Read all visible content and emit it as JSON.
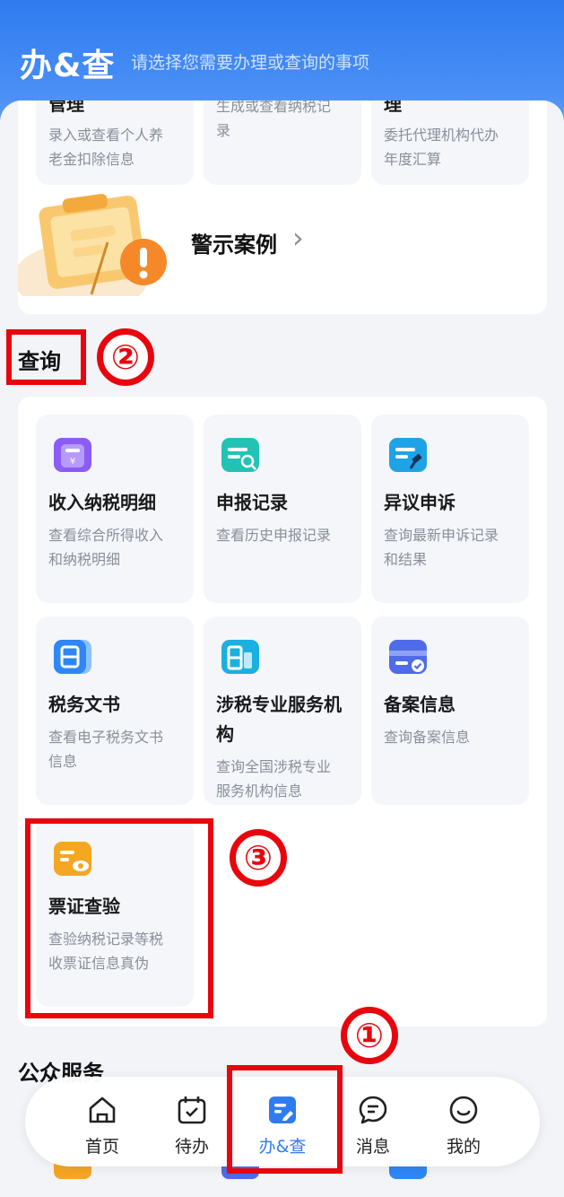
{
  "header": {
    "title": "办&查",
    "subtitle": "请选择您需要办理或查询的事项"
  },
  "top_tiles": [
    {
      "title": "管理",
      "desc_line1": "录入或查看个人养",
      "desc_line2": "老金扣除信息"
    },
    {
      "title": "",
      "desc_line1": "生成或查看纳税记",
      "desc_line2": "录"
    },
    {
      "title": "理",
      "desc_line1": "委托代理机构代办",
      "desc_line2": "年度汇算"
    }
  ],
  "warning": {
    "label": "警示案例",
    "chevron": "›"
  },
  "query_section": {
    "title": "查询",
    "tiles": [
      {
        "title": "收入纳税明细",
        "desc_line1": "查看综合所得收入",
        "desc_line2": "和纳税明细",
        "icon": "income-detail-icon",
        "color": "#8b5cf6"
      },
      {
        "title": "申报记录",
        "desc_line1": "查看历史申报记录",
        "desc_line2": "",
        "icon": "declaration-record-icon",
        "color": "#22c3b5"
      },
      {
        "title": "异议申诉",
        "desc_line1": "查询最新申诉记录",
        "desc_line2": "和结果",
        "icon": "appeal-icon",
        "color": "#1fa3e6"
      },
      {
        "title": "税务文书",
        "desc_line1": "查看电子税务文书",
        "desc_line2": "信息",
        "icon": "tax-document-icon",
        "color": "#2f86f6"
      },
      {
        "title_line1": "涉税专业服务机",
        "title_line2": "构",
        "desc_line1": "查询全国涉税专业",
        "desc_line2": "服务机构信息",
        "icon": "tax-agency-icon",
        "color": "#1ab0e0"
      },
      {
        "title": "备案信息",
        "desc_line1": "查询备案信息",
        "desc_line2": "",
        "icon": "filing-info-icon",
        "color": "#4f6be8"
      },
      {
        "title": "票证查验",
        "desc_line1": "查验纳税记录等税",
        "desc_line2": "收票证信息真伪",
        "icon": "ticket-verify-icon",
        "color": "#f5a623"
      }
    ]
  },
  "public_section": {
    "title": "公众服务"
  },
  "annotations": {
    "one": "①",
    "two": "②",
    "three": "③",
    "color": "#e8050d"
  },
  "tabbar": {
    "items": [
      {
        "label": "首页",
        "icon": "home-icon",
        "active": false
      },
      {
        "label": "待办",
        "icon": "todo-icon",
        "active": false
      },
      {
        "label": "办&查",
        "icon": "handle-query-icon",
        "active": true
      },
      {
        "label": "消息",
        "icon": "message-icon",
        "active": false
      },
      {
        "label": "我的",
        "icon": "profile-icon",
        "active": false
      }
    ],
    "active_color": "#2f7cf0"
  }
}
